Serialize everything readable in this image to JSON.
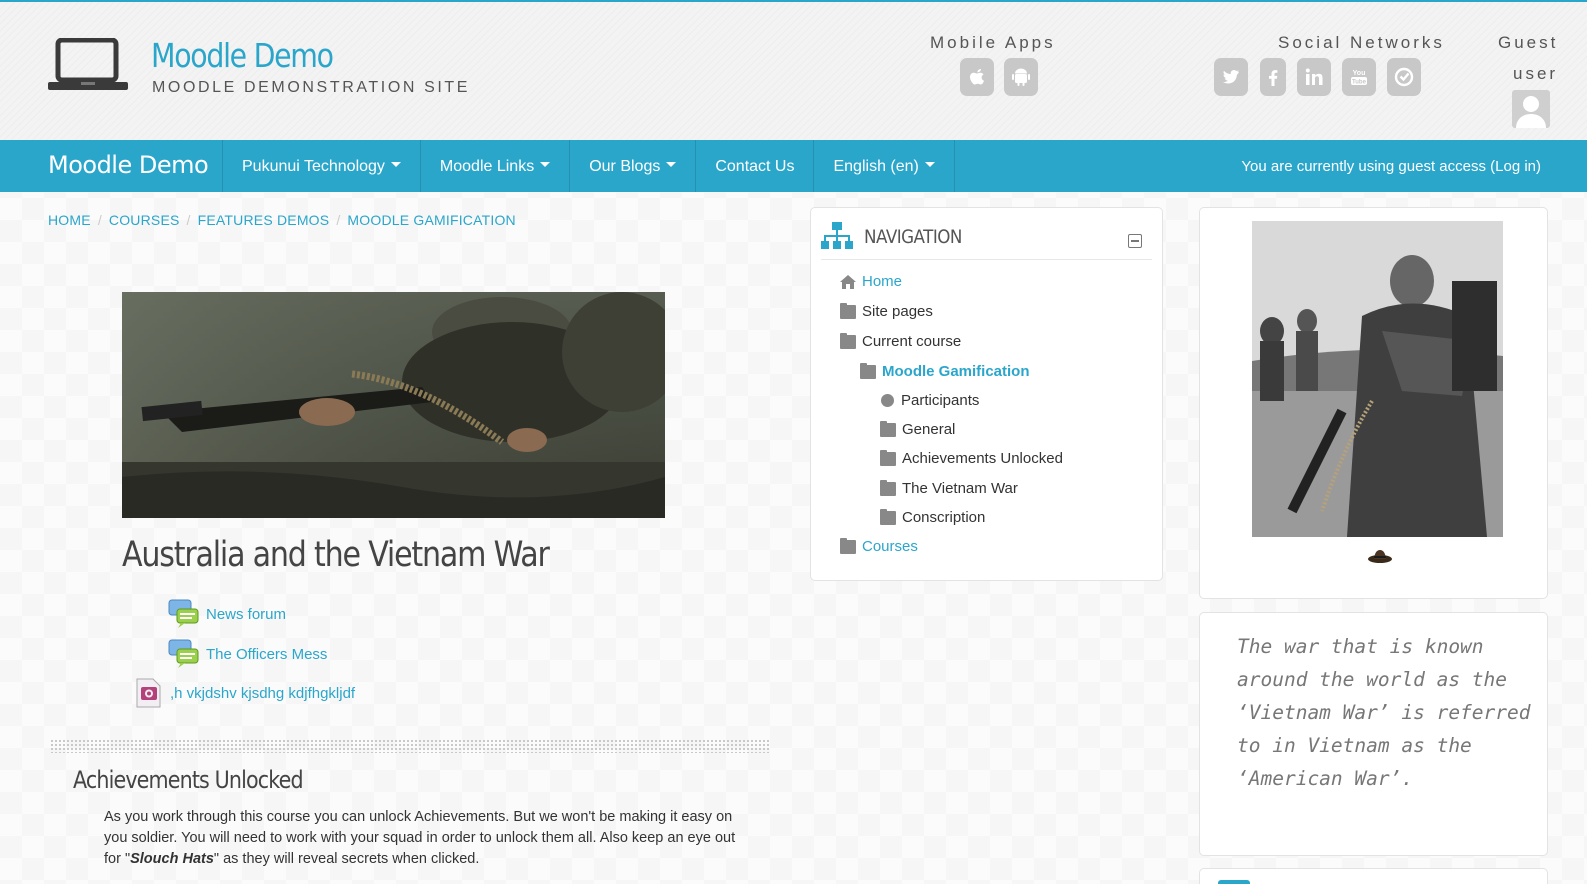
{
  "header": {
    "site_title": "Moodle Demo",
    "site_subtitle": "MOODLE DEMONSTRATION SITE",
    "mobile_apps_label": "Mobile Apps",
    "social_label": "Social Networks",
    "guest_line1": "Guest",
    "guest_line2": "user",
    "mobile_icons": [
      "apple-icon",
      "android-icon"
    ],
    "social_icons": [
      "twitter-icon",
      "facebook-icon",
      "linkedin-icon",
      "youtube-icon",
      "flickr-icon"
    ]
  },
  "navbar": {
    "brand": "Moodle Demo",
    "menu": [
      {
        "label": "Pukunui Technology",
        "dropdown": true
      },
      {
        "label": "Moodle Links",
        "dropdown": true
      },
      {
        "label": "Our Blogs",
        "dropdown": true
      },
      {
        "label": "Contact Us",
        "dropdown": false
      },
      {
        "label": "English (en)",
        "dropdown": true
      }
    ],
    "guest_access": "You are currently using guest access",
    "login_link": "(Log in)",
    "accent_color": "#2ba6cb"
  },
  "breadcrumb": [
    "HOME",
    "COURSES",
    "FEATURES DEMOS",
    "MOODLE GAMIFICATION"
  ],
  "course": {
    "title": "Australia and the Vietnam War",
    "activities": [
      {
        "label": "News forum",
        "icon": "forum-icon"
      },
      {
        "label": "The Officers Mess",
        "icon": "forum-icon"
      },
      {
        "label": ",h vkjdshv kjsdhg kdjfhgkljdf",
        "icon": "media-icon"
      }
    ],
    "section_title": "Achievements Unlocked",
    "section_text_1": "As you work through this course you can unlock Achievements. But we won't be making it easy on you soldier. You will need to work with your squad in order to unlock them all. Also keep an eye out for \"",
    "section_text_em": "Slouch Hats",
    "section_text_2": "\" as they will reveal secrets when clicked."
  },
  "navigation": {
    "title": "NAVIGATION",
    "items": [
      {
        "label": "Home",
        "icon": "home-icon",
        "link": true
      },
      {
        "label": "Site pages",
        "icon": "folder-icon",
        "link": false
      },
      {
        "label": "Current course",
        "icon": "folder-icon",
        "link": false
      },
      {
        "label": "Moodle Gamification",
        "icon": "folder-icon",
        "link": true
      },
      {
        "label": "Participants",
        "icon": "circle-icon",
        "link": false
      },
      {
        "label": "General",
        "icon": "folder-icon",
        "link": false
      },
      {
        "label": "Achievements Unlocked",
        "icon": "folder-icon",
        "link": false
      },
      {
        "label": "The Vietnam War",
        "icon": "folder-icon",
        "link": false
      },
      {
        "label": "Conscription",
        "icon": "folder-icon",
        "link": false
      },
      {
        "label": "Courses",
        "icon": "folder-icon",
        "link": true
      }
    ]
  },
  "sidebar": {
    "quote": "The war that is known around the world as the ‘Vietnam War’ is referred to in Vietnam as the ‘American War’."
  }
}
